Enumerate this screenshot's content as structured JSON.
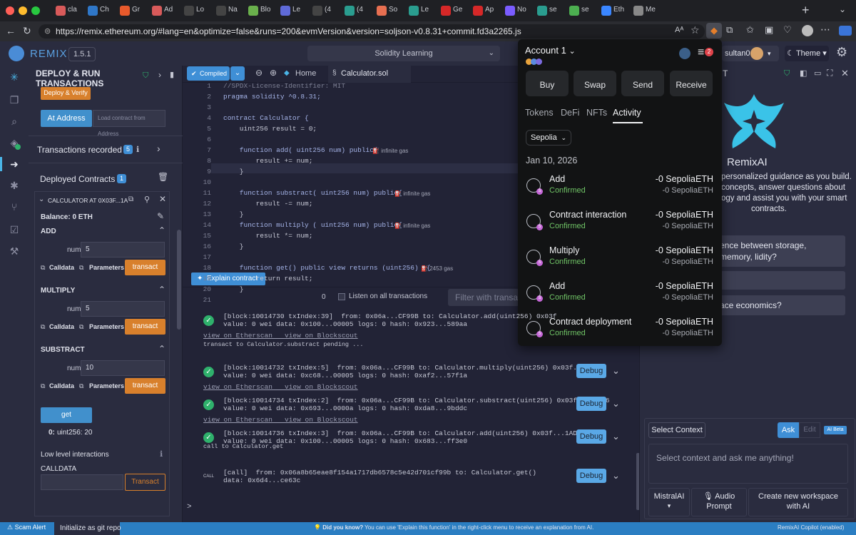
{
  "browser": {
    "tabs": [
      "cla",
      "Ch",
      "Gr",
      "Ad",
      "Lo",
      "Na",
      "Blo",
      "Le",
      "(4",
      "(4",
      "So",
      "Le",
      "Ge",
      "Ap",
      "No",
      "se",
      "se",
      "Eth",
      "Me"
    ],
    "tab_badge": "(4",
    "url": "https://remix.ethereum.org/#lang=en&optimize=false&runs=200&evmVersion&version=soljson-v0.8.31+commit.fd3a2265.js"
  },
  "remix": {
    "logo": "REMIX",
    "version": "1.5.1",
    "workspace_title": "Solidity Learning",
    "user_label": "sultan06",
    "theme_label": "Theme"
  },
  "deploy_panel": {
    "title": "DEPLOY & RUN TRANSACTIONS",
    "deploy_verify": "Deploy & Verify",
    "at_address": "At Address",
    "load_contract_placeholder": "Load contract from Address",
    "transactions_recorded": "Transactions recorded",
    "transactions_count": "5",
    "deployed_contracts": "Deployed Contracts",
    "deployed_count": "1",
    "instance_name": "CALCULATOR AT 0X03F...1A",
    "balance": "Balance: 0 ETH",
    "functions": [
      {
        "name": "ADD",
        "param_label": "num:",
        "param_value": "5"
      },
      {
        "name": "MULTIPLY",
        "param_label": "num:",
        "param_value": "5"
      },
      {
        "name": "SUBSTRACT",
        "param_label": "num:",
        "param_value": "10"
      }
    ],
    "calldata_label": "Calldata",
    "parameters_label": "Parameters",
    "transact_label": "transact",
    "get_label": "get",
    "get_result_prefix": "0:",
    "get_result": "uint256: 20",
    "low_level": "Low level interactions",
    "calldata_section": "CALLDATA",
    "transact_button": "Transact"
  },
  "editor": {
    "compiled_label": "Compiled",
    "home_tab": "Home",
    "file_tab": "Calculator.sol",
    "explain": "Explain contract",
    "line_numbers": [
      "1",
      "2",
      "3",
      "4",
      "5",
      "6",
      "7",
      "8",
      "9",
      "10",
      "11",
      "12",
      "13",
      "14",
      "15",
      "16",
      "17",
      "18",
      "19",
      "20",
      "21"
    ],
    "lines": [
      "//SPDX-License-Identifier: MIT",
      "pragma solidity ^0.8.31;",
      "",
      "contract Calculator {",
      "    uint256 result = 0;",
      "",
      "    function add( uint256 num) public{",
      "        result += num;",
      "    }",
      "",
      "    function substract( uint256 num) public{",
      "        result -= num;",
      "    }",
      "    function multiply ( uint256 num) public{",
      "        result *= num;",
      "    }",
      "",
      "    function get() public view returns (uint256)  {",
      "        return result;",
      "    }",
      ""
    ],
    "gas_labels": [
      {
        "line": 7,
        "text": "infinite gas"
      },
      {
        "line": 11,
        "text": "infinite gas"
      },
      {
        "line": 14,
        "text": "infinite gas"
      },
      {
        "line": 18,
        "text": "2453 gas"
      }
    ]
  },
  "terminal": {
    "count": "0",
    "listen_label": "Listen on all transactions",
    "filter_placeholder": "Filter with transa",
    "logs": [
      {
        "line1": "[block:10014730 txIndex:39]  from: 0x06a...CF99B to: Calculator.add(uint256) 0x03f",
        "line2": "value: 0 wei data: 0x100...00005 logs: 0 hash: 0x923...589aa",
        "links": "view on Etherscan   view on Blockscout",
        "extra": "transact to Calculator.substract pending ...",
        "debug": false
      },
      {
        "line1": "[block:10014732 txIndex:5]  from: 0x06a...CF99B to: Calculator.multiply(uint256) 0x03f...1AD96",
        "line2": "value: 0 wei data: 0xc68...00005 logs: 0 hash: 0xaf2...57f1a",
        "links": "view on Etherscan   view on Blockscout",
        "extra": "",
        "debug": true
      },
      {
        "line1": "[block:10014734 txIndex:2]  from: 0x06a...CF99B to: Calculator.substract(uint256) 0x03f...1AD96",
        "line2": "value: 0 wei data: 0x693...0000a logs: 0 hash: 0xda8...9bddc",
        "links": "view on Etherscan   view on Blockscout",
        "extra": "",
        "debug": true
      },
      {
        "line1": "[block:10014736 txIndex:3]  from: 0x06a...CF99B to: Calculator.add(uint256) 0x03f...1AD96",
        "line2": "value: 0 wei data: 0x100...00005 logs: 0 hash: 0x683...ff3e0",
        "links": "",
        "extra": "call to Calculator.get",
        "debug": true
      },
      {
        "line1": "[call]  from: 0x06a8b65eae8f154a1717db6578c5e42d701cf99b to: Calculator.get()",
        "line2": "data: 0x6d4...ce63c",
        "links": "",
        "extra": "",
        "debug": true
      }
    ],
    "call_tag": "CALL",
    "debug_label": "Debug",
    "prompt": ">"
  },
  "ai_panel": {
    "title": "RemixAI",
    "header_fragment": "T",
    "description": "personalized guidance as you build. concepts, answer questions about ogy and assist you with your smart contracts.",
    "desc_lines": [
      "personalized guidance as you build.",
      "concepts, answer questions about",
      "ogy and assist you with your smart",
      "contracts."
    ],
    "suggestions": [
      "ence between storage, memory, lidity?",
      "",
      "ace economics?"
    ],
    "select_context": "Select Context",
    "ask": "Ask",
    "edit": "Edit",
    "ai_beta": "AI Beta",
    "input_placeholder": "Select context and ask me anything!",
    "model": "MistralAI",
    "audio_prompt": "Audio Prompt",
    "new_workspace": "Create new workspace with AI"
  },
  "metamask": {
    "account": "Account 1",
    "badge_count": "2",
    "actions": [
      "Buy",
      "Swap",
      "Send",
      "Receive"
    ],
    "tabs": [
      "Tokens",
      "DeFi",
      "NFTs",
      "Activity"
    ],
    "network": "Sepolia",
    "date": "Jan 10, 2026",
    "transactions": [
      {
        "title": "Add",
        "status": "Confirmed",
        "amount": "-0 SepoliaETH",
        "amount2": "-0 SepoliaETH"
      },
      {
        "title": "Contract interaction",
        "status": "Confirmed",
        "amount": "-0 SepoliaETH",
        "amount2": "-0 SepoliaETH"
      },
      {
        "title": "Multiply",
        "status": "Confirmed",
        "amount": "-0 SepoliaETH",
        "amount2": "-0 SepoliaETH"
      },
      {
        "title": "Add",
        "status": "Confirmed",
        "amount": "-0 SepoliaETH",
        "amount2": "-0 SepoliaETH"
      },
      {
        "title": "Contract deployment",
        "status": "Confirmed",
        "amount": "-0 SepoliaETH",
        "amount2": "-0 SepoliaETH"
      }
    ]
  },
  "statusbar": {
    "scam_alert": "Scam Alert",
    "git": "Initialize as git repo",
    "did_you_know": "Did you know?",
    "tip": "You can use 'Explain this function' in the right-click menu to receive an explanation from AI.",
    "copilot": "RemixAI Copilot (enabled)"
  },
  "colors": {
    "bg": "#222336",
    "panel": "#2a2c3f",
    "accent": "#3f8fd6",
    "orange": "#d8802c",
    "green": "#2fb16c",
    "metamask_bg": "#121314"
  }
}
